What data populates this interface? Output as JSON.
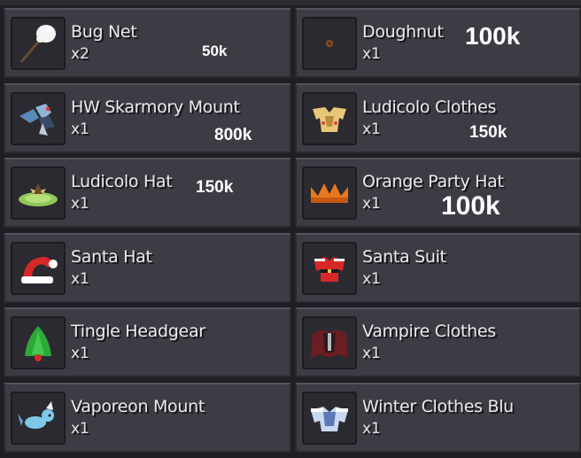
{
  "inventory": {
    "items": [
      {
        "name": "Bug Net",
        "qty": "x2",
        "price": "50k",
        "icon": "bug-net-icon"
      },
      {
        "name": "Doughnut",
        "qty": "x1",
        "price": "100k",
        "icon": "doughnut-icon"
      },
      {
        "name": "HW Skarmory Mount",
        "qty": "x1",
        "price": "800k",
        "icon": "skarmory-mount-icon"
      },
      {
        "name": "Ludicolo Clothes",
        "qty": "x1",
        "price": "150k",
        "icon": "ludicolo-clothes-icon"
      },
      {
        "name": "Ludicolo Hat",
        "qty": "x1",
        "price": "150k",
        "icon": "ludicolo-hat-icon"
      },
      {
        "name": "Orange Party Hat",
        "qty": "x1",
        "price": "100k",
        "icon": "orange-party-hat-icon"
      },
      {
        "name": "Santa Hat",
        "qty": "x1",
        "price": "",
        "icon": "santa-hat-icon"
      },
      {
        "name": "Santa Suit",
        "qty": "x1",
        "price": "",
        "icon": "santa-suit-icon"
      },
      {
        "name": "Tingle Headgear",
        "qty": "x1",
        "price": "",
        "icon": "tingle-headgear-icon"
      },
      {
        "name": "Vampire Clothes",
        "qty": "x1",
        "price": "",
        "icon": "vampire-clothes-icon"
      },
      {
        "name": "Vaporeon Mount",
        "qty": "x1",
        "price": "",
        "icon": "vaporeon-mount-icon"
      },
      {
        "name": "Winter Clothes Blu",
        "qty": "x1",
        "price": "",
        "icon": "winter-clothes-icon"
      }
    ]
  },
  "colors": {
    "slot_bg": "#3d3c44",
    "icon_bg": "#2b2a30",
    "text": "#e9e9ec",
    "price_text": "#ffffff"
  }
}
